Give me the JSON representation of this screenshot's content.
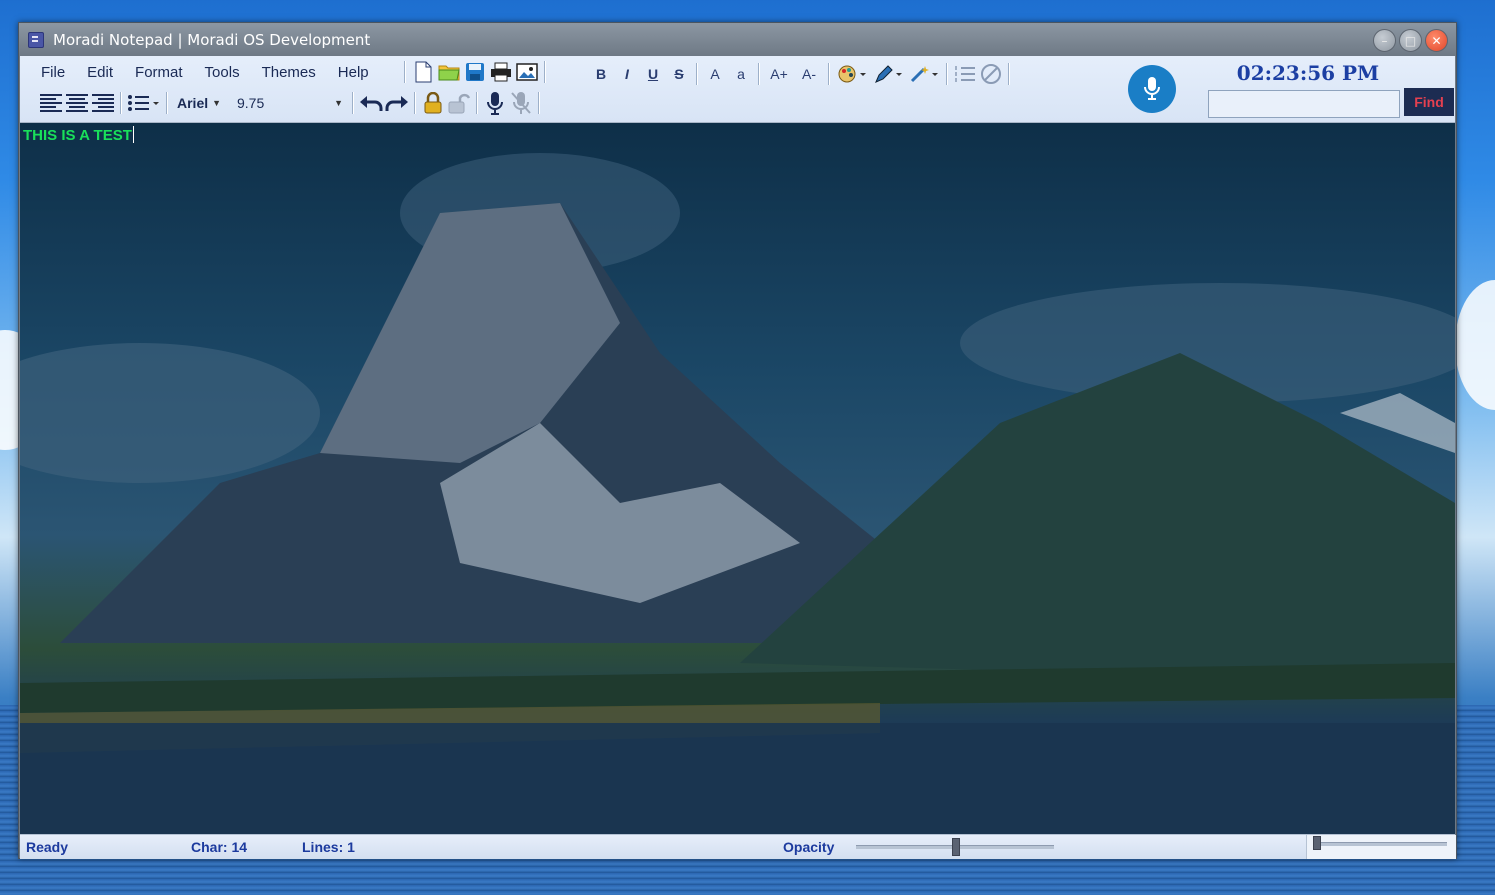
{
  "window": {
    "title": "Moradi Notepad | Moradi OS Development",
    "buttons": {
      "minimize": "–",
      "maximize": "□",
      "close": "✕"
    }
  },
  "menu": [
    "File",
    "Edit",
    "Format",
    "Tools",
    "Themes",
    "Help"
  ],
  "toolbar": {
    "icons_row1": [
      "new-file-icon",
      "open-folder-icon",
      "save-icon",
      "print-icon",
      "insert-image-icon"
    ],
    "format_buttons": {
      "bold": "B",
      "italic": "I",
      "underline": "U",
      "strikethrough": "S",
      "uppercase": "A",
      "lowercase": "a",
      "grow_font": "A+",
      "shrink_font": "A-"
    },
    "font_name": "Ariel",
    "font_size": "9.75",
    "clock": "02:23:56 PM",
    "find_label": "Find",
    "find_value": ""
  },
  "editor": {
    "text": "THIS IS A TEST",
    "text_color": "#19e05a"
  },
  "status": {
    "state": "Ready",
    "char": "Char: 14",
    "lines": "Lines: 1",
    "opacity_label": "Opacity",
    "opacity_value": 0.5
  },
  "colors": {
    "accent": "#1a7ec6",
    "find_bg": "#1c2c52",
    "find_text": "#e54050",
    "clock": "#1c3fa3"
  }
}
